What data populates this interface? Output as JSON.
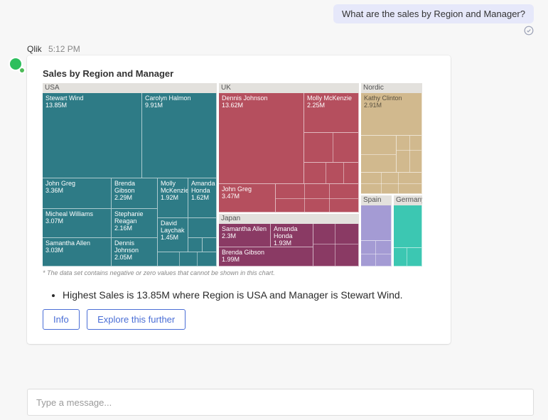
{
  "user_message": "What are the sales by Region and Manager?",
  "sender": {
    "name": "Qlik",
    "time": "5:12 PM"
  },
  "card": {
    "title": "Sales by Region and Manager",
    "footnote": "* The data set contains negative or zero values that cannot be shown in this chart.",
    "insight": "Highest Sales is 13.85M where Region is USA and Manager is Stewart Wind.",
    "buttons": {
      "info": "Info",
      "explore": "Explore this further"
    }
  },
  "compose": {
    "placeholder": "Type a message..."
  },
  "headers": {
    "usa": "USA",
    "uk": "UK",
    "japan": "Japan",
    "nordic": "Nordic",
    "spain": "Spain",
    "germany": "Germany"
  },
  "cells": {
    "usa_stewart": {
      "name": "Stewart Wind",
      "value": "13.85M"
    },
    "usa_carolyn": {
      "name": "Carolyn Halmon",
      "value": "9.91M"
    },
    "usa_johngreg": {
      "name": "John Greg",
      "value": "3.36M"
    },
    "usa_brenda": {
      "name": "Brenda Gibson",
      "value": "2.29M"
    },
    "usa_molly": {
      "name": "Molly McKenzie",
      "value": "1.92M"
    },
    "usa_amanda": {
      "name": "Amanda Honda",
      "value": "1.62M"
    },
    "usa_micheal": {
      "name": "Micheal Williams",
      "value": "3.07M"
    },
    "usa_stephanie": {
      "name": "Stephanie Reagan",
      "value": "2.16M"
    },
    "usa_david": {
      "name": "David Laychak",
      "value": "1.45M"
    },
    "usa_samantha": {
      "name": "Samantha Allen",
      "value": "3.03M"
    },
    "usa_dennis": {
      "name": "Dennis Johnson",
      "value": "2.05M"
    },
    "uk_dennis": {
      "name": "Dennis Johnson",
      "value": "13.62M"
    },
    "uk_molly": {
      "name": "Molly McKenzie",
      "value": "2.25M"
    },
    "uk_johngreg": {
      "name": "John Greg",
      "value": "3.47M"
    },
    "jp_samantha": {
      "name": "Samantha Allen",
      "value": "2.3M"
    },
    "jp_amanda": {
      "name": "Amanda Honda",
      "value": "1.93M"
    },
    "jp_brenda": {
      "name": "Brenda Gibson",
      "value": "1.99M"
    },
    "nor_kathy": {
      "name": "Kathy Clinton",
      "value": "2.91M"
    }
  },
  "chart_data": {
    "type": "treemap",
    "title": "Sales by Region and Manager",
    "value_label": "Sales",
    "value_unit": "M",
    "footnote": "The data set contains negative or zero values that cannot be shown in this chart.",
    "regions": [
      {
        "name": "USA",
        "color": "#2e7b86",
        "managers": [
          {
            "name": "Stewart Wind",
            "value": 13.85
          },
          {
            "name": "Carolyn Halmon",
            "value": 9.91
          },
          {
            "name": "John Greg",
            "value": 3.36
          },
          {
            "name": "Micheal Williams",
            "value": 3.07
          },
          {
            "name": "Samantha Allen",
            "value": 3.03
          },
          {
            "name": "Brenda Gibson",
            "value": 2.29
          },
          {
            "name": "Stephanie Reagan",
            "value": 2.16
          },
          {
            "name": "Dennis Johnson",
            "value": 2.05
          },
          {
            "name": "Molly McKenzie",
            "value": 1.92
          },
          {
            "name": "Amanda Honda",
            "value": 1.62
          },
          {
            "name": "David Laychak",
            "value": 1.45
          }
        ]
      },
      {
        "name": "UK",
        "color": "#b54f5e",
        "managers": [
          {
            "name": "Dennis Johnson",
            "value": 13.62
          },
          {
            "name": "John Greg",
            "value": 3.47
          },
          {
            "name": "Molly McKenzie",
            "value": 2.25
          }
        ]
      },
      {
        "name": "Japan",
        "color": "#8a3a64",
        "managers": [
          {
            "name": "Samantha Allen",
            "value": 2.3
          },
          {
            "name": "Brenda Gibson",
            "value": 1.99
          },
          {
            "name": "Amanda Honda",
            "value": 1.93
          }
        ]
      },
      {
        "name": "Nordic",
        "color": "#d1b98e",
        "managers": [
          {
            "name": "Kathy Clinton",
            "value": 2.91
          }
        ]
      },
      {
        "name": "Spain",
        "color": "#a49bd4",
        "managers": []
      },
      {
        "name": "Germany",
        "color": "#3cc7b2",
        "managers": []
      }
    ]
  }
}
